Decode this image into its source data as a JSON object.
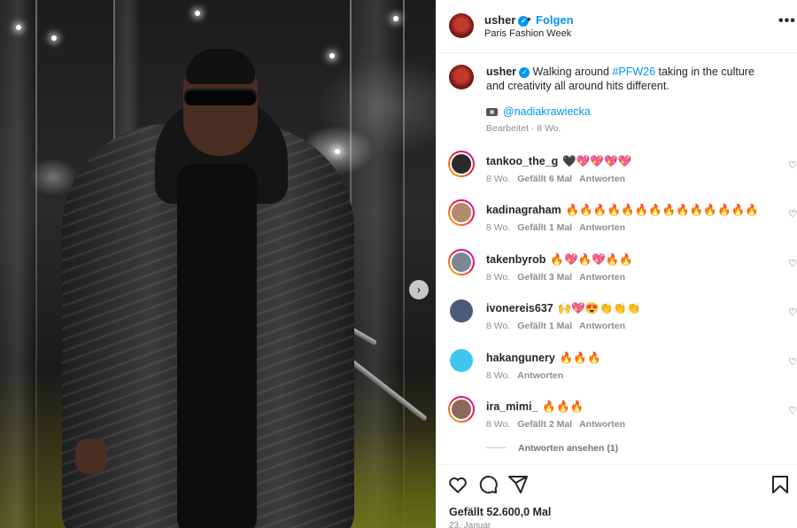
{
  "post": {
    "username": "usher",
    "follow_label": "Folgen",
    "separator": "•",
    "location": "Paris Fashion Week",
    "more_label": "•••",
    "next_label": "›",
    "caption": {
      "username": "usher",
      "text_before": "Walking around ",
      "hashtag": "#PFW26",
      "text_after": " taking in the culture and creativity all around hits different.",
      "credit_handle": "@nadiakrawiecka",
      "edited": "Bearbeitet · 8 Wo."
    }
  },
  "comments": [
    {
      "username": "tankoo_the_g",
      "text": "🖤💖💖💖💖",
      "age": "8 Wo.",
      "likes": "Gefällt 6 Mal",
      "reply": "Antworten",
      "avatar_color": "#2b2b2b",
      "story_ring": true
    },
    {
      "username": "kadinagraham",
      "text": "🔥🔥🔥🔥🔥🔥🔥🔥🔥🔥🔥🔥🔥🔥",
      "age": "8 Wo.",
      "likes": "Gefällt 1 Mal",
      "reply": "Antworten",
      "avatar_color": "#b48a6b",
      "story_ring": true
    },
    {
      "username": "takenbyrob",
      "text": "🔥💖🔥💖🔥🔥",
      "age": "8 Wo.",
      "likes": "Gefällt 3 Mal",
      "reply": "Antworten",
      "avatar_color": "#7b8796",
      "story_ring": true
    },
    {
      "username": "ivonereis637",
      "text": "🙌💖😍👏👏👏",
      "age": "8 Wo.",
      "likes": "Gefällt 1 Mal",
      "reply": "Antworten",
      "avatar_color": "#4a5a78",
      "story_ring": false
    },
    {
      "username": "hakangunery",
      "text": "🔥🔥🔥",
      "age": "8 Wo.",
      "likes": "",
      "reply": "Antworten",
      "avatar_color": "#3ec6f0",
      "story_ring": false
    },
    {
      "username": "ira_mimi_",
      "text": "🔥🔥🔥",
      "age": "8 Wo.",
      "likes": "Gefällt 2 Mal",
      "reply": "Antworten",
      "avatar_color": "#8a6a5a",
      "story_ring": true
    }
  ],
  "view_replies": "Antworten ansehen (1)",
  "footer": {
    "likes": "Gefällt 52.600,0 Mal",
    "date": "23. Januar"
  },
  "icons": {
    "like": "heart-icon",
    "comment": "comment-icon",
    "share": "send-icon",
    "save": "bookmark-icon"
  },
  "colors": {
    "accent": "#0095f6",
    "muted": "#8e8e8e",
    "text": "#262626"
  }
}
